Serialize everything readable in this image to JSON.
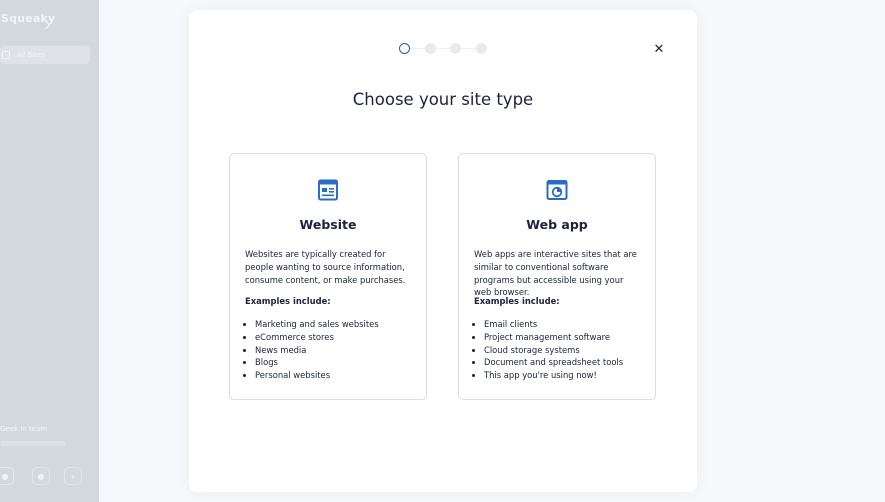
{
  "sidebar": {
    "logo": "Squeaky",
    "nav_label": "All Sites",
    "team_label": "Geek in team"
  },
  "modal": {
    "title": "Choose your site type",
    "close_glyph": "✕",
    "steps": 4,
    "active_step": 1,
    "cards": [
      {
        "title": "Website",
        "icon": "website-icon",
        "description": "Websites are typically created for people wanting to source information, consume content, or make purchases.",
        "examples_heading": "Examples include:",
        "examples": [
          "Marketing and sales websites",
          "eCommerce stores",
          "News media",
          "Blogs",
          "Personal websites"
        ]
      },
      {
        "title": "Web app",
        "icon": "web-app-chart-icon",
        "description": "Web apps are interactive sites that are similar to conventional software programs but accessible using your web browser.",
        "examples_heading": "Examples include:",
        "examples": [
          "Email clients",
          "Project management software",
          "Cloud storage systems",
          "Document and spreadsheet tools",
          "This app you're using now!"
        ]
      }
    ]
  },
  "colors": {
    "accent": "#2a6dc7",
    "text": "#1b2140",
    "sidebar": "#d3d7de",
    "card_border": "#dadde3"
  }
}
